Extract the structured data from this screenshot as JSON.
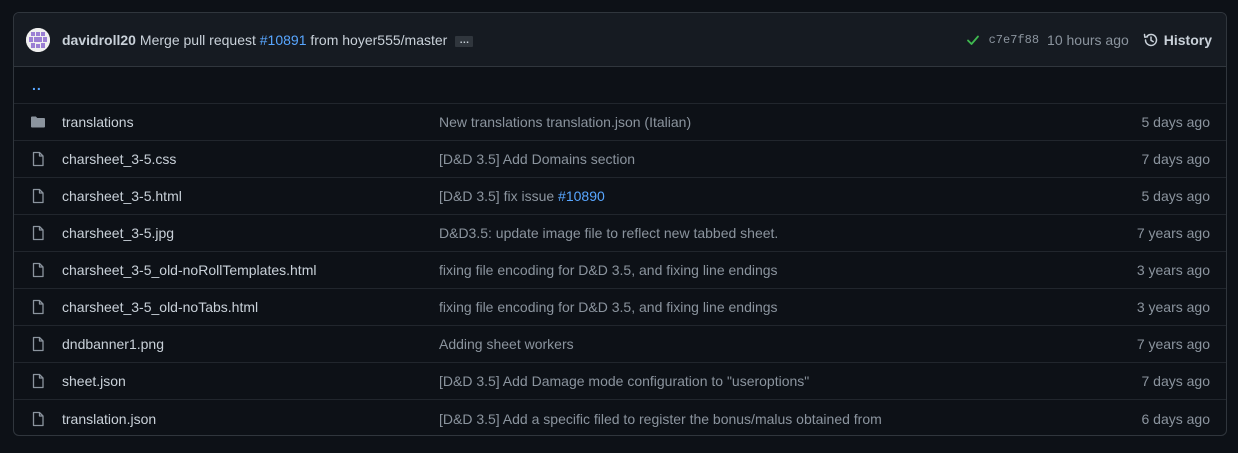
{
  "commit": {
    "author": "davidroll20",
    "message_prefix": "Merge pull request",
    "pr_number": "#10891",
    "message_suffix": "from hoyer555/master",
    "ellipsis": "…",
    "status_icon": "check-icon",
    "sha": "c7e7f88",
    "time": "10 hours ago",
    "history_label": "History"
  },
  "parent_link": "..",
  "files": [
    {
      "type": "folder",
      "name": "translations",
      "message": "New translations translation.json (Italian)",
      "link": "",
      "age": "5 days ago"
    },
    {
      "type": "file",
      "name": "charsheet_3-5.css",
      "message": "[D&D 3.5] Add Domains section",
      "link": "",
      "age": "7 days ago"
    },
    {
      "type": "file",
      "name": "charsheet_3-5.html",
      "message": "[D&D 3.5] fix issue ",
      "link": "#10890",
      "age": "5 days ago"
    },
    {
      "type": "file",
      "name": "charsheet_3-5.jpg",
      "message": "D&D3.5: update image file to reflect new tabbed sheet.",
      "link": "",
      "age": "7 years ago"
    },
    {
      "type": "file",
      "name": "charsheet_3-5_old-noRollTemplates.html",
      "message": "fixing file encoding for D&D 3.5, and fixing line endings",
      "link": "",
      "age": "3 years ago"
    },
    {
      "type": "file",
      "name": "charsheet_3-5_old-noTabs.html",
      "message": "fixing file encoding for D&D 3.5, and fixing line endings",
      "link": "",
      "age": "3 years ago"
    },
    {
      "type": "file",
      "name": "dndbanner1.png",
      "message": "Adding sheet workers",
      "link": "",
      "age": "7 years ago"
    },
    {
      "type": "file",
      "name": "sheet.json",
      "message": "[D&D 3.5] Add Damage mode configuration to \"useroptions\"",
      "link": "",
      "age": "7 days ago"
    },
    {
      "type": "file",
      "name": "translation.json",
      "message": "[D&D 3.5] Add a specific filed to register the bonus/malus obtained from",
      "link": "",
      "age": "6 days ago"
    }
  ],
  "colors": {
    "background": "#0d1117",
    "header_bg": "#161b22",
    "border": "#30363d",
    "link": "#58a6ff",
    "muted": "#8b949e",
    "text": "#c9d1d9",
    "success": "#3fb950"
  }
}
